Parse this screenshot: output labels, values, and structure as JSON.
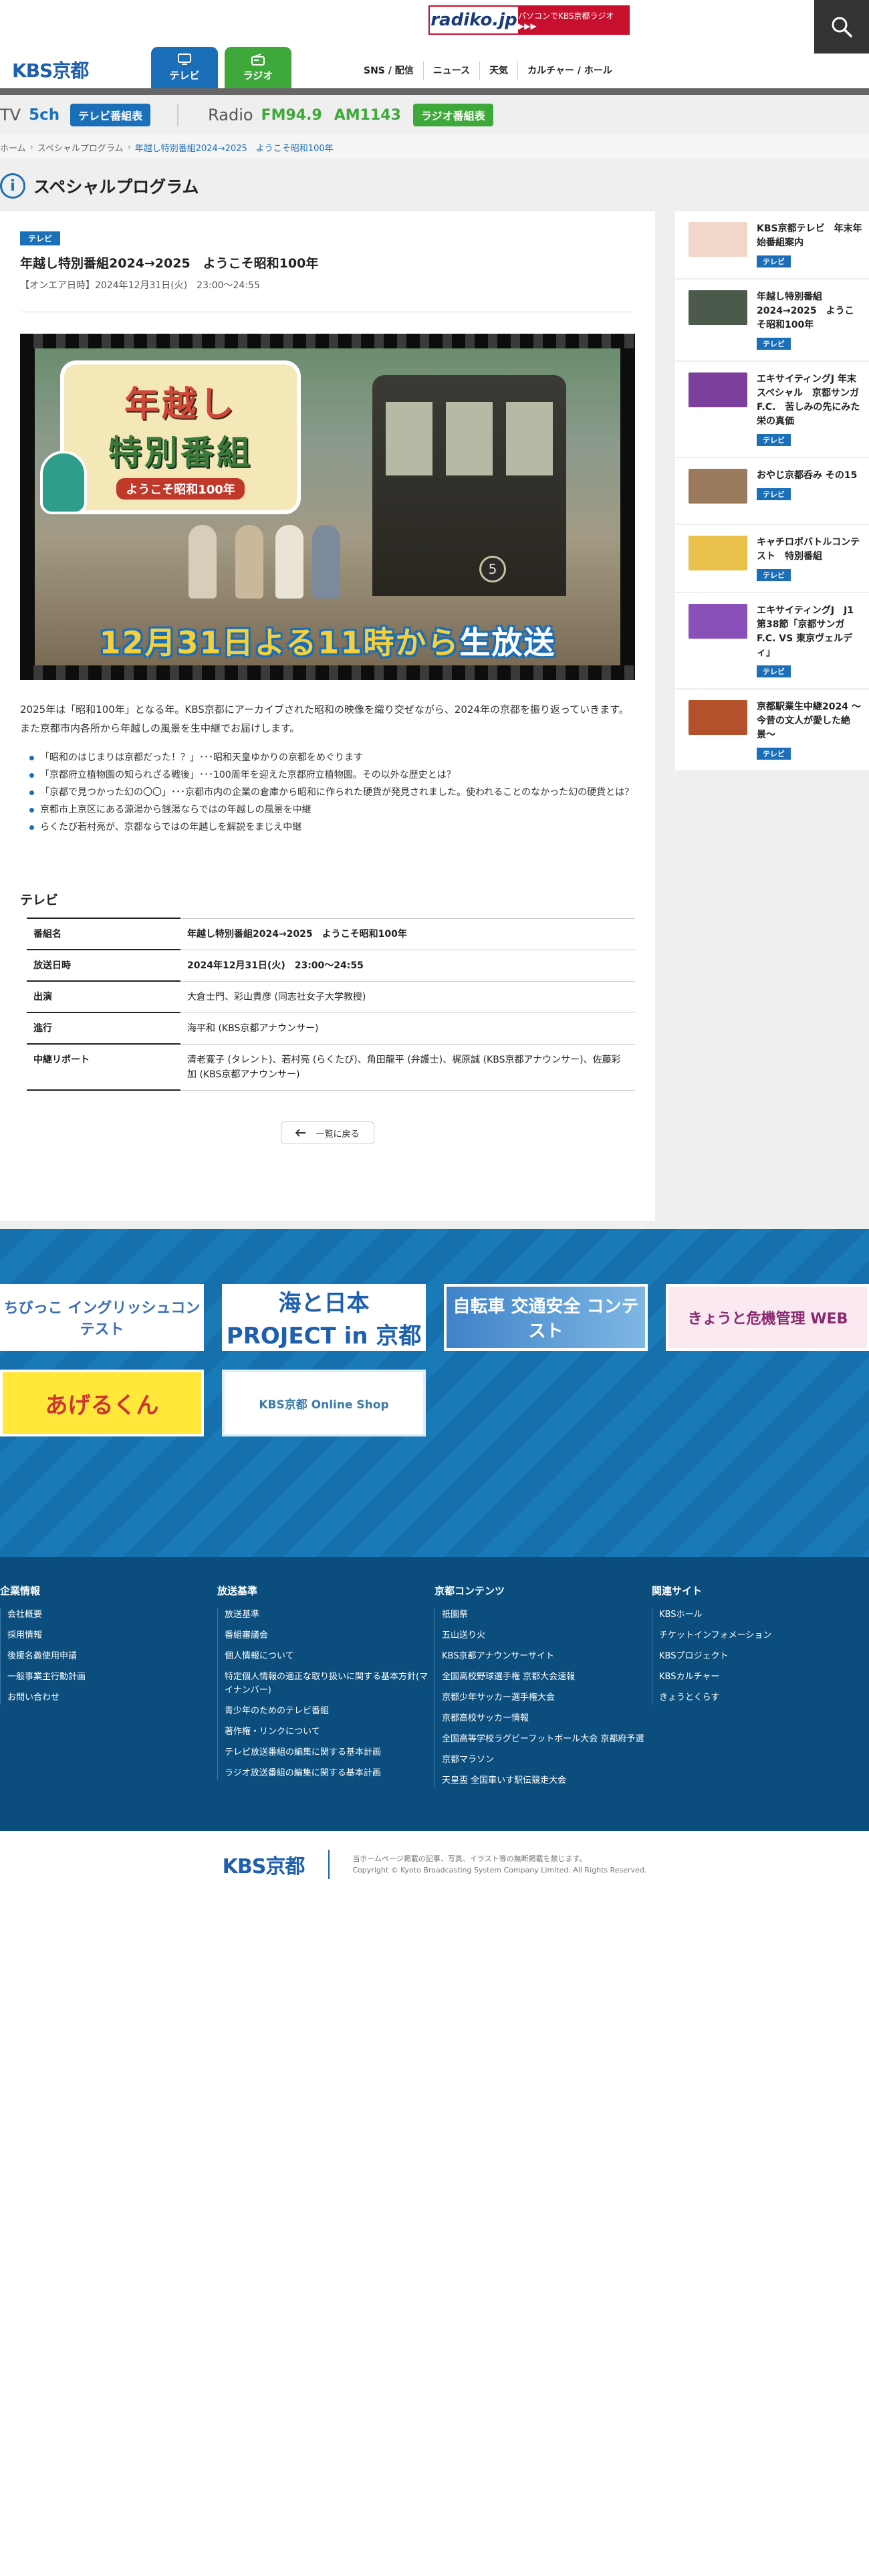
{
  "radiko": {
    "logo": "radiko.jp",
    "text": "パソコンでKBS京都ラジオ ▶▶▶"
  },
  "site_logo": "KBS京都",
  "nav_tabs": {
    "tv": "テレビ",
    "radio": "ラジオ"
  },
  "global_nav": [
    "SNS / 配信",
    "ニュース",
    "天気",
    "カルチャー / ホール"
  ],
  "schedule": {
    "tv_label": "TV",
    "tv_channel": "5ch",
    "tv_button": "テレビ番組表",
    "radio_label": "Radio",
    "fm": "FM94.9",
    "am": "AM1143",
    "radio_button": "ラジオ番組表"
  },
  "breadcrumb": [
    "ホーム",
    "スペシャルプログラム",
    "年越し特別番組2024→2025　ようこそ昭和100年"
  ],
  "section_title": "スペシャルプログラム",
  "article": {
    "badge": "テレビ",
    "title": "年越し特別番組2024→2025　ようこそ昭和100年",
    "date": "【オンエア日時】2024年12月31日(火)　23:00〜24:55",
    "hero_title_1": "年越し",
    "hero_title_2": "特別番組",
    "hero_title_3": "ようこそ昭和100年",
    "hero_tram_number": "5",
    "hero_airtime_a": "12月31日よる11時から",
    "hero_airtime_b": "生放送",
    "body": "2025年は「昭和100年」となる年。KBS京都にアーカイブされた昭和の映像を織り交ぜながら、2024年の京都を振り返っていきます。また京都市内各所から年越しの風景を生中継でお届けします。",
    "bullets": [
      "「昭和のはじまりは京都だった！？」･･･昭和天皇ゆかりの京都をめぐります",
      "「京都府立植物園の知られざる戦後」･･･100周年を迎えた京都府立植物園。その以外な歴史とは？",
      "「京都で見つかった幻の〇〇」･･･京都市内の企業の倉庫から昭和に作られた硬貨が発見されました。使われることのなかった幻の硬貨とは？",
      "京都市上京区にある源湯から銭湯ならではの年越しの風景を中継",
      "らくたび若村亮が、京都ならではの年越しを解説をまじえ中継"
    ],
    "program_heading": "テレビ",
    "program_rows": [
      {
        "label": "番組名",
        "value": "年越し特別番組2024→2025　ようこそ昭和100年",
        "bold": true
      },
      {
        "label": "放送日時",
        "value": "2024年12月31日(火)　23:00〜24:55",
        "bold": true
      },
      {
        "label": "出演",
        "value": "大倉士門、彩山貴彦 (同志社女子大学教授)",
        "bold": false
      },
      {
        "label": "進行",
        "value": "海平和 (KBS京都アナウンサー)",
        "bold": false
      },
      {
        "label": "中継リポート",
        "value": "清老寛子 (タレント)、若村亮 (らくたび)、角田龍平 (弁護士)、梶原誠 (KBS京都アナウンサー)、佐藤彩加 (KBS京都アナウンサー)",
        "bold": false
      }
    ],
    "back_button": "一覧に戻る"
  },
  "sidebar": [
    {
      "title": "KBS京都テレビ　年末年始番組案内",
      "badge": "テレビ",
      "color": "#f1d7c9"
    },
    {
      "title": "年越し特別番組2024→2025　ようこそ昭和100年",
      "badge": "テレビ",
      "color": "#4b5a4a"
    },
    {
      "title": "エキサイティングJ 年末スペシャル　京都サンガF.C.　苦しみの先にみた栄の真価",
      "badge": "テレビ",
      "color": "#7b3f9e"
    },
    {
      "title": "おやじ京都呑み その15",
      "badge": "テレビ",
      "color": "#9c7b5c"
    },
    {
      "title": "キャチロボバトルコンテスト　特別番組",
      "badge": "テレビ",
      "color": "#e8c04a"
    },
    {
      "title": "エキサイティングJ　J1第38節「京都サンガF.C. VS 東京ヴェルディ」",
      "badge": "テレビ",
      "color": "#8a4fb8"
    },
    {
      "title": "京都駅業生中継2024 〜今昔の文人が愛した絶景〜",
      "badge": "テレビ",
      "color": "#b3522a"
    }
  ],
  "banners": {
    "b1": "ちびっこ イングリッシュコンテスト",
    "b2": "海と日本 PROJECT in 京都",
    "b3": "自転車 交通安全 コンテスト",
    "b4": "きょうと危機管理 WEB",
    "b5": "あげるくん",
    "b6": "KBS京都 Online Shop"
  },
  "footer": {
    "cols": [
      {
        "title": "企業情報",
        "items": [
          "会社概要",
          "採用情報",
          "後援名義使用申請",
          "一般事業主行動計画",
          "お問い合わせ"
        ]
      },
      {
        "title": "放送基準",
        "items": [
          "放送基準",
          "番組審議会",
          "個人情報について",
          "特定個人情報の適正な取り扱いに関する基本方針(マイナンバー)",
          "青少年のためのテレビ番組",
          "著作権・リンクについて",
          "テレビ放送番組の編集に関する基本計画",
          "ラジオ放送番組の編集に関する基本計画"
        ]
      },
      {
        "title": "京都コンテンツ",
        "items": [
          "祇園祭",
          "五山送り火",
          "KBS京都アナウンサーサイト",
          "全国高校野球選手権 京都大会速報",
          "京都少年サッカー選手権大会",
          "京都高校サッカー情報",
          "全国高等学校ラグビーフットボール大会 京都府予選",
          "京都マラソン",
          "天皇盃 全国車いす駅伝競走大会"
        ]
      },
      {
        "title": "関連サイト",
        "items": [
          "KBSホール",
          "チケットインフォメーション",
          "KBSプロジェクト",
          "KBSカルチャー",
          "きょうとくらす"
        ]
      }
    ],
    "logo": "KBS京都",
    "notice": "当ホームページ掲載の記事、写真、イラスト等の無断掲載を禁じます。",
    "copyright": "Copyright © Kyoto Broadcasting System Company Limited. All Rights Reserved."
  },
  "colors": {
    "tv_blue": "#1b6fb8",
    "radio_green": "#3ea83a",
    "footer_navy": "#0b4e7e"
  }
}
